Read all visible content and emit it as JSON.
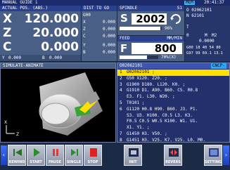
{
  "title_bar": {
    "mode": "MANUAL GUIDE i",
    "badge": "MEM",
    "time": "20:41:37"
  },
  "position": {
    "header": "ACTUAL POS. (ABS.)",
    "axes": [
      {
        "name": "X",
        "value": "120.000"
      },
      {
        "name": "Z",
        "value": "20.000"
      },
      {
        "name": "C",
        "value": "0.000"
      }
    ],
    "footer_y": "Y",
    "footer_y_val": "0.000",
    "footer_b": "B",
    "footer_b_val": "0.000"
  },
  "dist_to_go": {
    "header": "DIST TO GO",
    "rows": [
      {
        "axis": "X",
        "value": "0.000"
      },
      {
        "axis": "Z",
        "value": "0.000"
      },
      {
        "axis": "C",
        "value": "0.000"
      },
      {
        "axis": "Y",
        "value": "0.000"
      },
      {
        "axis": "B",
        "value": "0.000"
      }
    ],
    "top_label": "G00"
  },
  "spindle": {
    "header": "SPINDLE",
    "channel": "S1",
    "label": "S",
    "value": "2002",
    "load_percent": "96%",
    "load_fraction": 0.96,
    "icon": "spindle-rotate-icon"
  },
  "feed": {
    "header": "FEED",
    "unit": "MM/MIN",
    "label": "F",
    "value": "800",
    "override": "70%(X)",
    "level_fraction": 0.7
  },
  "modal": {
    "program": "O 02062101",
    "seq": "N 62101",
    "tool": "T",
    "m_label": "M",
    "m_value": "M2",
    "s_value": "0",
    "f_value": "0.0000",
    "g_row1": "G00 18 40 54 80",
    "g_row2": "G97 99 69.1  13.1"
  },
  "simulation": {
    "header": "SIMULATE-ANIMATE",
    "axis_z": "Z",
    "axis_x": "X"
  },
  "program": {
    "header": "O02062101",
    "tag": "CNCP-",
    "lines": [
      {
        "n": "1",
        "text": "O02062101 ;",
        "current": true
      },
      {
        "n": "2",
        "text": "G50 X120. Z20. ;",
        "current": false
      },
      {
        "n": "3",
        "text": "G1900 D180. L120. K0. ;",
        "current": false
      },
      {
        "n": "4",
        "text": "G1910 D1. A90. B60. C5. R0.8",
        "current": false
      },
      {
        "n": "",
        "text": "E3. F1. L30. W20. ;",
        "current": false
      },
      {
        "n": "5",
        "text": "T0101 ;",
        "current": false
      },
      {
        "n": "6",
        "text": "G1120 H0.8 H90. B60. J3. P1.",
        "current": false
      },
      {
        "n": "",
        "text": "S3. U3. H100. C0.5 L3. K3.",
        "current": false
      },
      {
        "n": "",
        "text": "F0.5 C0.5 W0.5 K100. W1. U1.",
        "current": false
      },
      {
        "n": "",
        "text": "X1. Y1. ;",
        "current": false
      },
      {
        "n": "7",
        "text": "G1450 H3. V50. ;",
        "current": false
      },
      {
        "n": "8",
        "text": "G1451 H3. V25. K7. V25. L0. M0.",
        "current": false
      }
    ]
  },
  "softkeys": [
    {
      "label": "REWIND",
      "icon": "rewind-icon"
    },
    {
      "label": "START",
      "icon": "play-icon"
    },
    {
      "label": "PAUSE",
      "icon": "pause-icon"
    },
    {
      "label": "SINGLE",
      "icon": "single-step-icon"
    },
    {
      "label": "STOP",
      "icon": "stop-icon"
    },
    {
      "label": "INIT",
      "icon": "init-icon"
    },
    {
      "label": "REVERS",
      "icon": "reverse-icon"
    },
    {
      "label": "SETTING",
      "icon": "setting-icon"
    }
  ],
  "nav": {
    "left": "‹",
    "right": "›"
  },
  "colors": {
    "accent": "#2b3f8f",
    "panel": "#4a5f86",
    "highlight": "#ffe000"
  }
}
